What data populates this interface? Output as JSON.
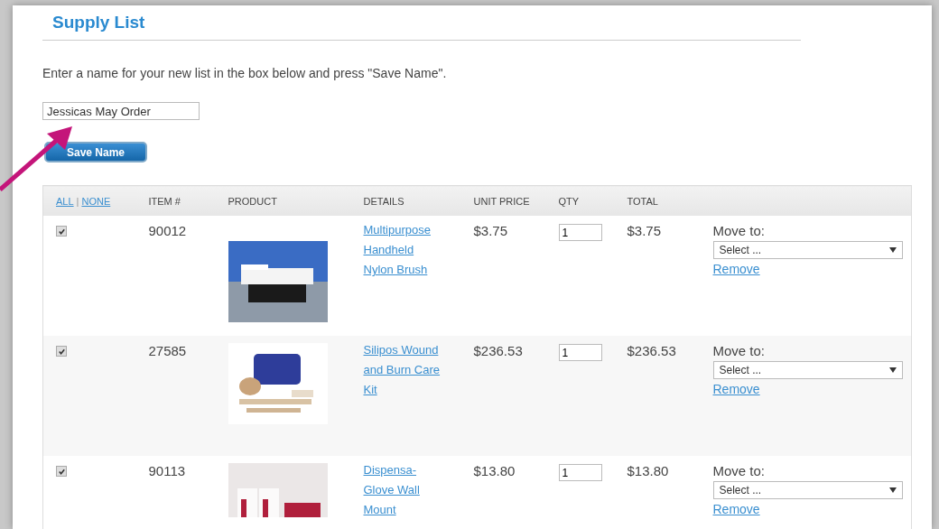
{
  "title": "Supply List",
  "instruction": "Enter a name for your new list in the box below and press \"Save Name\".",
  "name_field": {
    "value": "Jessicas May Order"
  },
  "save_button": "Save Name",
  "table": {
    "select_links": [
      "ALL",
      "NONE"
    ],
    "select_separator": "|",
    "columns": [
      "ITEM #",
      "PRODUCT",
      "DETAILS",
      "UNIT PRICE",
      "QTY",
      "TOTAL"
    ],
    "rows": [
      {
        "checked": true,
        "item": "90012",
        "details": "Multipurpose Handheld Nylon Brush",
        "unit_price": "$3.75",
        "qty": "1",
        "total": "$3.75",
        "move_label": "Move to:",
        "move_select": "Select ...",
        "remove": "Remove"
      },
      {
        "checked": true,
        "item": "27585",
        "details": "Silipos Wound and Burn Care Kit",
        "unit_price": "$236.53",
        "qty": "1",
        "total": "$236.53",
        "move_label": "Move to:",
        "move_select": "Select ...",
        "remove": "Remove"
      },
      {
        "checked": true,
        "item": "90113",
        "details": "Dispensa-Glove Wall Mount",
        "unit_price": "$13.80",
        "qty": "1",
        "total": "$13.80",
        "move_label": "Move to:",
        "move_select": "Select ...",
        "remove": "Remove"
      }
    ]
  }
}
